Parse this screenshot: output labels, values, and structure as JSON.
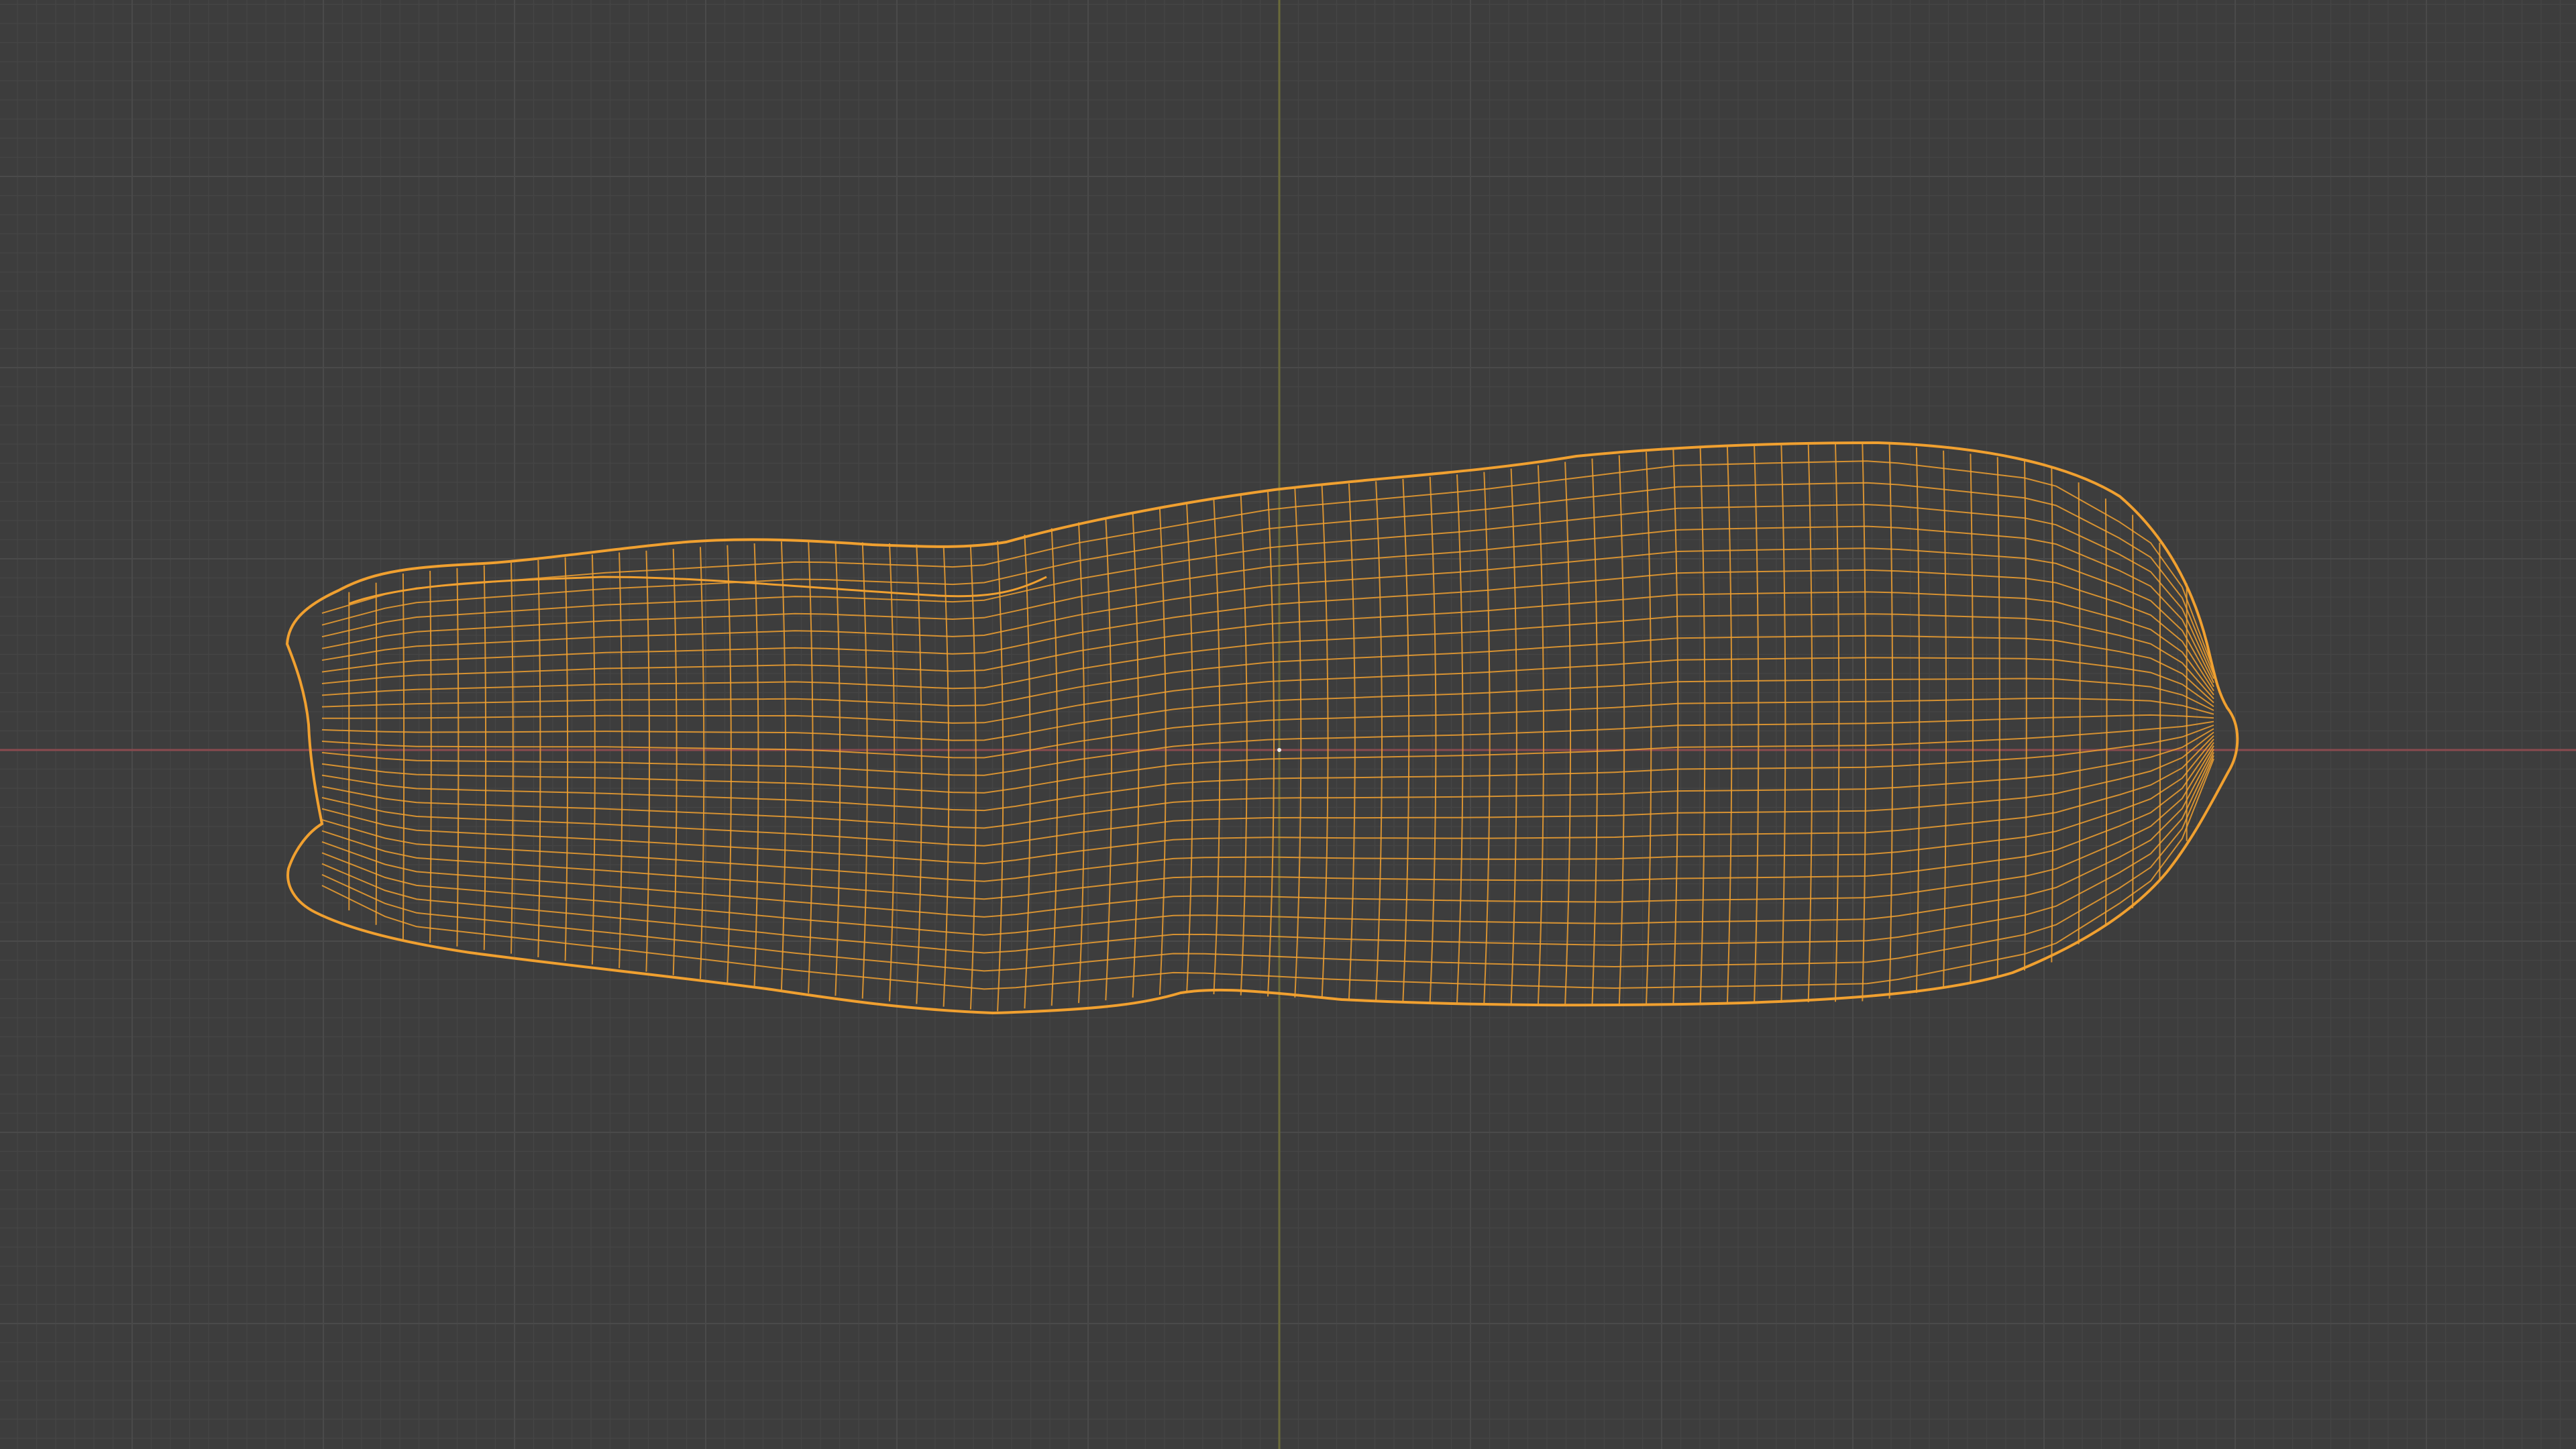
{
  "viewport": {
    "mode": "wireframe",
    "object": "mesh",
    "object_selected": true,
    "grid_visible": true,
    "axes_visible": [
      "x",
      "z"
    ]
  },
  "colors": {
    "background": "#3d3d3d",
    "grid_minor": "#454545",
    "grid_major": "#4a4a4a",
    "x_axis": "#8a4a4f",
    "z_axis": "#6b6b3a",
    "wire_selected": "#f0a030"
  },
  "icons": {
    "origin": "origin-dot-icon"
  }
}
